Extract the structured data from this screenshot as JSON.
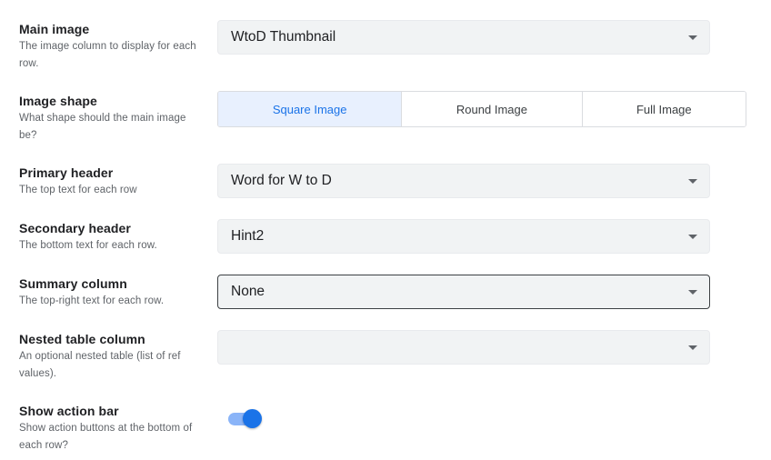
{
  "settings": {
    "main_image": {
      "title": "Main image",
      "description": "The image column to display for each row.",
      "value": "WtoD Thumbnail"
    },
    "image_shape": {
      "title": "Image shape",
      "description": "What shape should the main image be?",
      "options": [
        "Square Image",
        "Round Image",
        "Full Image"
      ],
      "selected": "Square Image"
    },
    "primary_header": {
      "title": "Primary header",
      "description": "The top text for each row",
      "value": "Word for W to D"
    },
    "secondary_header": {
      "title": "Secondary header",
      "description": "The bottom text for each row.",
      "value": "Hint2"
    },
    "summary_column": {
      "title": "Summary column",
      "description": "The top-right text for each row.",
      "value": "None"
    },
    "nested_table_column": {
      "title": "Nested table column",
      "description": "An optional nested table (list of ref values).",
      "value": ""
    },
    "show_action_bar": {
      "title": "Show action bar",
      "description": "Show action buttons at the bottom of each row?",
      "enabled": true
    }
  },
  "colors": {
    "accent": "#1a73e8",
    "accent_light": "#e8f0fe",
    "field_bg": "#f1f3f4"
  },
  "icons": {
    "dropdown": "chevron-down-icon"
  }
}
